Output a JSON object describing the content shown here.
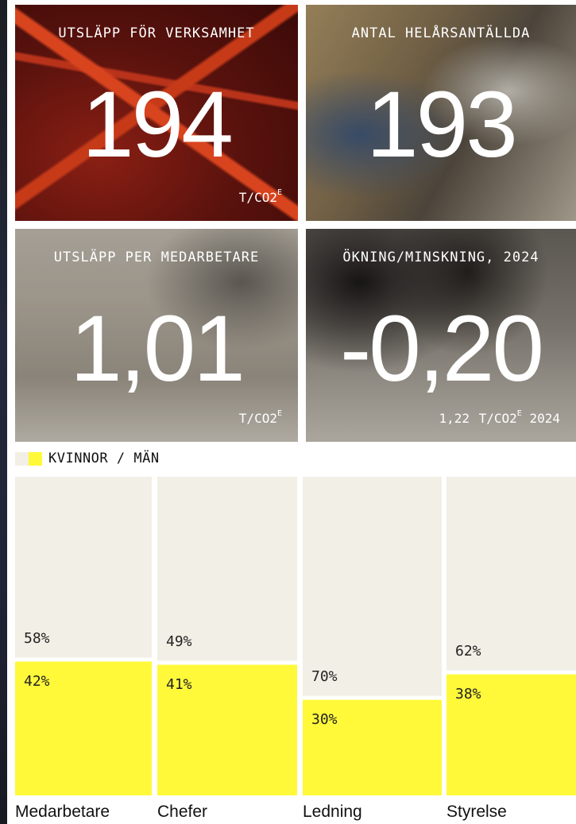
{
  "tiles": [
    {
      "label": "UTSLÄPP FÖR VERKSAMHET",
      "value": "194",
      "unit": "T/CO2",
      "unit_sup": "E",
      "unit_prefix": ""
    },
    {
      "label": "ANTAL HELÅRSANTÄLLDA",
      "value": "193",
      "unit": "",
      "unit_sup": "",
      "unit_prefix": ""
    },
    {
      "label": "UTSLÄPP PER MEDARBETARE",
      "value": "1,01",
      "unit": "T/CO2",
      "unit_sup": "E",
      "unit_prefix": ""
    },
    {
      "label": "ÖKNING/MINSKNING, 2024",
      "value": "-0,20",
      "unit": "T/CO2",
      "unit_sup": "E",
      "unit_prefix": "1,22",
      "unit_suffix": "2024"
    }
  ],
  "chart_data": {
    "type": "bar",
    "legend": "KVINNOR / MÄN",
    "categories": [
      "Medarbetare",
      "Chefer",
      "Ledning",
      "Styrelse"
    ],
    "series": [
      {
        "name": "KVINNOR",
        "values": [
          58,
          49,
          70,
          62
        ],
        "labels": [
          "58%",
          "49%",
          "70%",
          "62%"
        ],
        "color": "#f2efe6"
      },
      {
        "name": "MÄN",
        "values": [
          42,
          41,
          30,
          38
        ],
        "labels": [
          "42%",
          "41%",
          "30%",
          "38%"
        ],
        "color": "#fff93a"
      }
    ]
  }
}
